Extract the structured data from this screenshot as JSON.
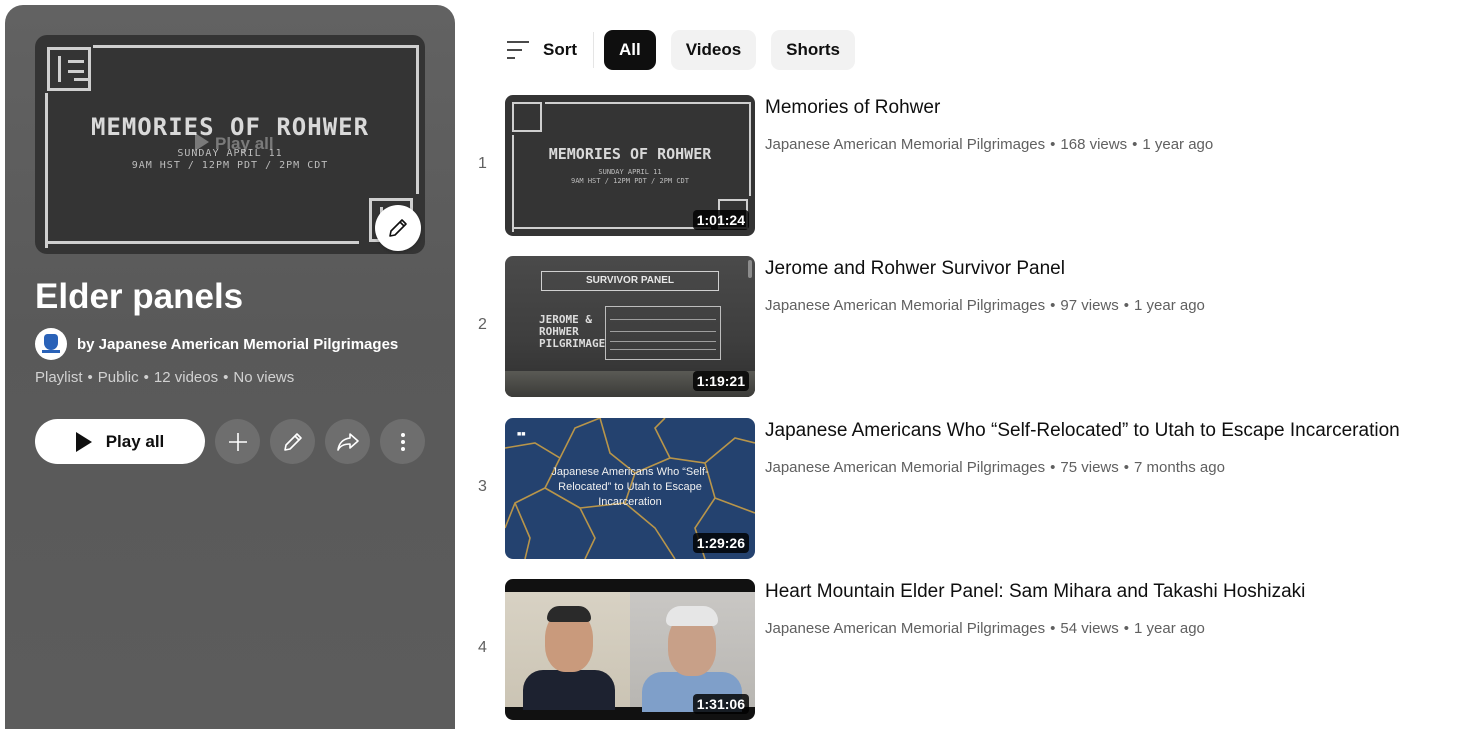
{
  "playlist": {
    "title": "Elder panels",
    "owner": "by Japanese American Memorial Pilgrimages",
    "meta": [
      "Playlist",
      "Public",
      "12 videos",
      "No views"
    ],
    "thumbnail": {
      "title": "MEMORIES OF ROHWER",
      "subtitle_line1": "SUNDAY APRIL 11",
      "subtitle_line2": "9AM HST / 12PM PDT / 2PM CDT",
      "overlay_text": "Play all"
    },
    "play_all_label": "Play all",
    "action_icons": [
      "plus-icon",
      "pencil-icon",
      "share-icon",
      "more-vert-icon"
    ]
  },
  "filters": {
    "sort_label": "Sort",
    "chips": [
      {
        "label": "All",
        "active": true
      },
      {
        "label": "Videos",
        "active": false
      },
      {
        "label": "Shorts",
        "active": false
      }
    ]
  },
  "videos": [
    {
      "index": "1",
      "title": "Memories of Rohwer",
      "channel": "Japanese American Memorial Pilgrimages",
      "views": "168 views",
      "age": "1 year ago",
      "duration": "1:01:24",
      "thumb": {
        "title": "MEMORIES OF ROHWER",
        "line1": "SUNDAY APRIL 11",
        "line2": "9AM HST / 12PM PDT / 2PM CDT"
      }
    },
    {
      "index": "2",
      "title": "Jerome and Rohwer Survivor Panel",
      "channel": "Japanese American Memorial Pilgrimages",
      "views": "97 views",
      "age": "1 year ago",
      "duration": "1:19:21",
      "thumb": {
        "banner": "SURVIVOR PANEL",
        "brand": "JEROME & ROHWER PILGRIMAGE"
      }
    },
    {
      "index": "3",
      "title": "Japanese Americans Who “Self-Relocated” to Utah to Escape Incarceration",
      "channel": "Japanese American Memorial Pilgrimages",
      "views": "75 views",
      "age": "7 months ago",
      "duration": "1:29:26",
      "thumb": {
        "caption": "Japanese Americans Who “Self-Relocated” to Utah to Escape Incarceration"
      }
    },
    {
      "index": "4",
      "title": "Heart Mountain Elder Panel: Sam Mihara and Takashi Hoshizaki",
      "channel": "Japanese American Memorial Pilgrimages",
      "views": "54 views",
      "age": "1 year ago",
      "duration": "1:31:06"
    }
  ],
  "colors": {
    "header_panel": "#5e5e5e",
    "chip_active": "#0f0f0f",
    "chip_inactive": "#f2f2f2",
    "meta_text": "#606060"
  }
}
